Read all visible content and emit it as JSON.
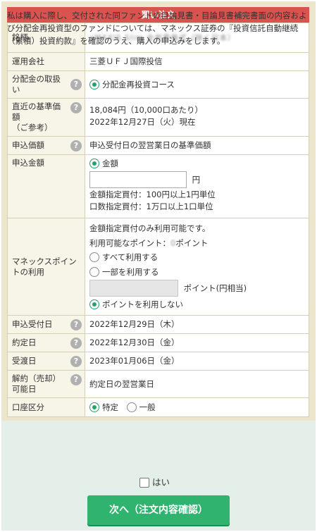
{
  "header": {
    "title": "買い注文"
  },
  "rows": {
    "brand": {
      "label": "銘柄",
      "value": "eMAXIS Slim 全世界株式（除く日本）"
    },
    "manager": {
      "label": "運用会社",
      "value": "三菱ＵＦＪ国際投信"
    },
    "distribution": {
      "label": "分配金の取扱い",
      "option": "分配金再投資コース"
    },
    "nav": {
      "label": "直近の基準価額",
      "sublabel": "（ご参考）",
      "price": "18,084円（10,000口あたり）",
      "date": "2022年12月27日（火）現在"
    },
    "order_price": {
      "label": "申込価額",
      "value": "申込受付日の翌営業日の基準価額"
    },
    "amount": {
      "label": "申込金額",
      "option": "金額",
      "input_value": "",
      "unit": "円",
      "note1": "金額指定買付：100円以上1円単位",
      "note2": "口数指定買付：1万口以上1口単位"
    },
    "points": {
      "label": "マネックスポイントの利用",
      "note": "金額指定買付のみ利用可能です。",
      "available_prefix": "利用可能なポイント：",
      "available_value": "0",
      "available_suffix": "ポイント",
      "opt_all": "すべて利用する",
      "opt_part": "一部を利用する",
      "input_value": "",
      "unit": "ポイント(円相当)",
      "opt_none": "ポイントを利用しない"
    },
    "order_date": {
      "label": "申込受付日",
      "value": "2022年12月29日（木）"
    },
    "contract_date": {
      "label": "約定日",
      "value": "2022年12月30日（金）"
    },
    "delivery_date": {
      "label": "受渡日",
      "value": "2023年01月06日（金）"
    },
    "cancel_date": {
      "label": "解約（売却）可能日",
      "value": "約定日の翌営業日"
    },
    "account": {
      "label": "口座区分",
      "opt_specific": "特定",
      "opt_general": "一般"
    }
  },
  "notice": {
    "text": "私は購入に際し、交付された同ファンドの目論見書・目論見書補完書面の内容および分配金再投資型のファンドについては、マネックス証券の『投資信託自動継続（累積）投資約款』を確認のうえ、購入の申込みをします。",
    "agree_label": "はい"
  },
  "submit": {
    "label": "次へ（注文内容確認）"
  },
  "colors": {
    "header": "#d9534f",
    "accent": "#2fb36e",
    "frame": "#ece6cd",
    "notice_bg": "#e4efe9"
  },
  "icons": {
    "help": "question-circle-icon"
  }
}
